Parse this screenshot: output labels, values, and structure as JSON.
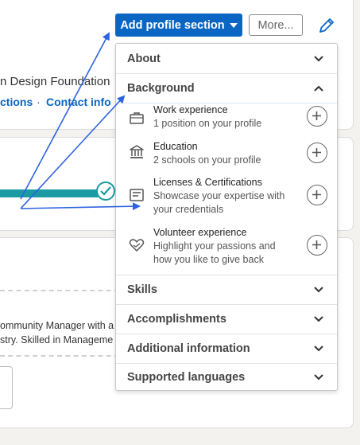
{
  "background_card": {
    "org_text": "n Design Foundation",
    "connections_link": "ctions",
    "separator_dot": "·",
    "contact_info_link": "Contact info",
    "summary_line_1": "ommunity Manager with a",
    "summary_line_2": "stry. Skilled in Manageme"
  },
  "toolbar": {
    "add_section_label": "Add profile section",
    "more_label": "More..."
  },
  "menu": {
    "about": "About",
    "background": "Background",
    "items": [
      {
        "title": "Work experience",
        "desc": "1 position on your profile",
        "icon": "briefcase-icon"
      },
      {
        "title": "Education",
        "desc": "2 schools on your profile",
        "icon": "school-icon"
      },
      {
        "title": "Licenses & Certifications",
        "desc": "Showcase your expertise with your credentials",
        "icon": "certificate-icon"
      },
      {
        "title": "Volunteer experience",
        "desc": "Highlight your passions and how you like to give back",
        "icon": "heart-hand-icon"
      }
    ],
    "skills": "Skills",
    "accomplishments": "Accomplishments",
    "additional_information": "Additional information",
    "supported_languages": "Supported languages"
  },
  "colors": {
    "primary": "#0a66c2",
    "progress": "#1a9ba3",
    "arrow": "#2e63e0"
  }
}
